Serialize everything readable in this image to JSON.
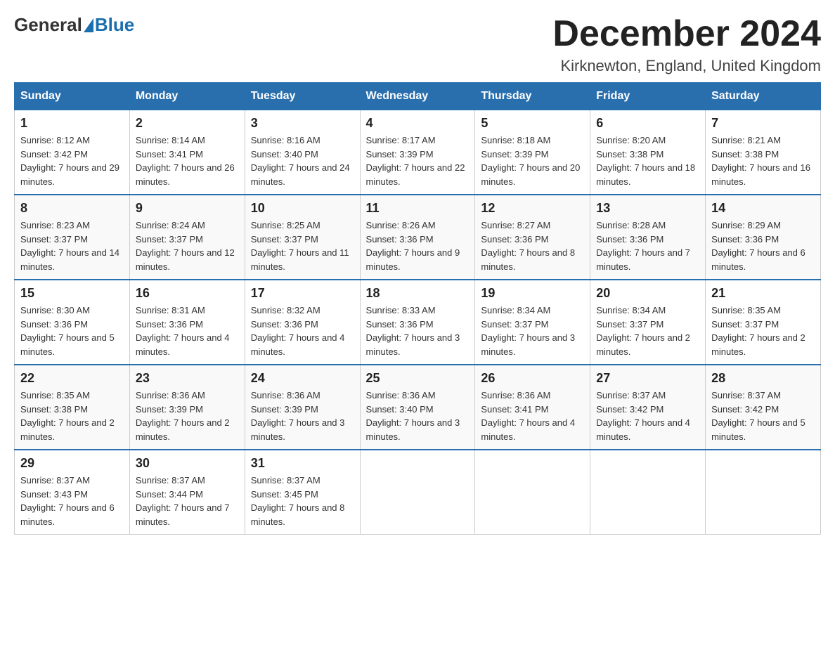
{
  "header": {
    "logo_general": "General",
    "logo_blue": "Blue",
    "title": "December 2024",
    "location": "Kirknewton, England, United Kingdom"
  },
  "days_of_week": [
    "Sunday",
    "Monday",
    "Tuesday",
    "Wednesday",
    "Thursday",
    "Friday",
    "Saturday"
  ],
  "weeks": [
    [
      {
        "day": "1",
        "sunrise": "8:12 AM",
        "sunset": "3:42 PM",
        "daylight": "7 hours and 29 minutes."
      },
      {
        "day": "2",
        "sunrise": "8:14 AM",
        "sunset": "3:41 PM",
        "daylight": "7 hours and 26 minutes."
      },
      {
        "day": "3",
        "sunrise": "8:16 AM",
        "sunset": "3:40 PM",
        "daylight": "7 hours and 24 minutes."
      },
      {
        "day": "4",
        "sunrise": "8:17 AM",
        "sunset": "3:39 PM",
        "daylight": "7 hours and 22 minutes."
      },
      {
        "day": "5",
        "sunrise": "8:18 AM",
        "sunset": "3:39 PM",
        "daylight": "7 hours and 20 minutes."
      },
      {
        "day": "6",
        "sunrise": "8:20 AM",
        "sunset": "3:38 PM",
        "daylight": "7 hours and 18 minutes."
      },
      {
        "day": "7",
        "sunrise": "8:21 AM",
        "sunset": "3:38 PM",
        "daylight": "7 hours and 16 minutes."
      }
    ],
    [
      {
        "day": "8",
        "sunrise": "8:23 AM",
        "sunset": "3:37 PM",
        "daylight": "7 hours and 14 minutes."
      },
      {
        "day": "9",
        "sunrise": "8:24 AM",
        "sunset": "3:37 PM",
        "daylight": "7 hours and 12 minutes."
      },
      {
        "day": "10",
        "sunrise": "8:25 AM",
        "sunset": "3:37 PM",
        "daylight": "7 hours and 11 minutes."
      },
      {
        "day": "11",
        "sunrise": "8:26 AM",
        "sunset": "3:36 PM",
        "daylight": "7 hours and 9 minutes."
      },
      {
        "day": "12",
        "sunrise": "8:27 AM",
        "sunset": "3:36 PM",
        "daylight": "7 hours and 8 minutes."
      },
      {
        "day": "13",
        "sunrise": "8:28 AM",
        "sunset": "3:36 PM",
        "daylight": "7 hours and 7 minutes."
      },
      {
        "day": "14",
        "sunrise": "8:29 AM",
        "sunset": "3:36 PM",
        "daylight": "7 hours and 6 minutes."
      }
    ],
    [
      {
        "day": "15",
        "sunrise": "8:30 AM",
        "sunset": "3:36 PM",
        "daylight": "7 hours and 5 minutes."
      },
      {
        "day": "16",
        "sunrise": "8:31 AM",
        "sunset": "3:36 PM",
        "daylight": "7 hours and 4 minutes."
      },
      {
        "day": "17",
        "sunrise": "8:32 AM",
        "sunset": "3:36 PM",
        "daylight": "7 hours and 4 minutes."
      },
      {
        "day": "18",
        "sunrise": "8:33 AM",
        "sunset": "3:36 PM",
        "daylight": "7 hours and 3 minutes."
      },
      {
        "day": "19",
        "sunrise": "8:34 AM",
        "sunset": "3:37 PM",
        "daylight": "7 hours and 3 minutes."
      },
      {
        "day": "20",
        "sunrise": "8:34 AM",
        "sunset": "3:37 PM",
        "daylight": "7 hours and 2 minutes."
      },
      {
        "day": "21",
        "sunrise": "8:35 AM",
        "sunset": "3:37 PM",
        "daylight": "7 hours and 2 minutes."
      }
    ],
    [
      {
        "day": "22",
        "sunrise": "8:35 AM",
        "sunset": "3:38 PM",
        "daylight": "7 hours and 2 minutes."
      },
      {
        "day": "23",
        "sunrise": "8:36 AM",
        "sunset": "3:39 PM",
        "daylight": "7 hours and 2 minutes."
      },
      {
        "day": "24",
        "sunrise": "8:36 AM",
        "sunset": "3:39 PM",
        "daylight": "7 hours and 3 minutes."
      },
      {
        "day": "25",
        "sunrise": "8:36 AM",
        "sunset": "3:40 PM",
        "daylight": "7 hours and 3 minutes."
      },
      {
        "day": "26",
        "sunrise": "8:36 AM",
        "sunset": "3:41 PM",
        "daylight": "7 hours and 4 minutes."
      },
      {
        "day": "27",
        "sunrise": "8:37 AM",
        "sunset": "3:42 PM",
        "daylight": "7 hours and 4 minutes."
      },
      {
        "day": "28",
        "sunrise": "8:37 AM",
        "sunset": "3:42 PM",
        "daylight": "7 hours and 5 minutes."
      }
    ],
    [
      {
        "day": "29",
        "sunrise": "8:37 AM",
        "sunset": "3:43 PM",
        "daylight": "7 hours and 6 minutes."
      },
      {
        "day": "30",
        "sunrise": "8:37 AM",
        "sunset": "3:44 PM",
        "daylight": "7 hours and 7 minutes."
      },
      {
        "day": "31",
        "sunrise": "8:37 AM",
        "sunset": "3:45 PM",
        "daylight": "7 hours and 8 minutes."
      },
      null,
      null,
      null,
      null
    ]
  ]
}
